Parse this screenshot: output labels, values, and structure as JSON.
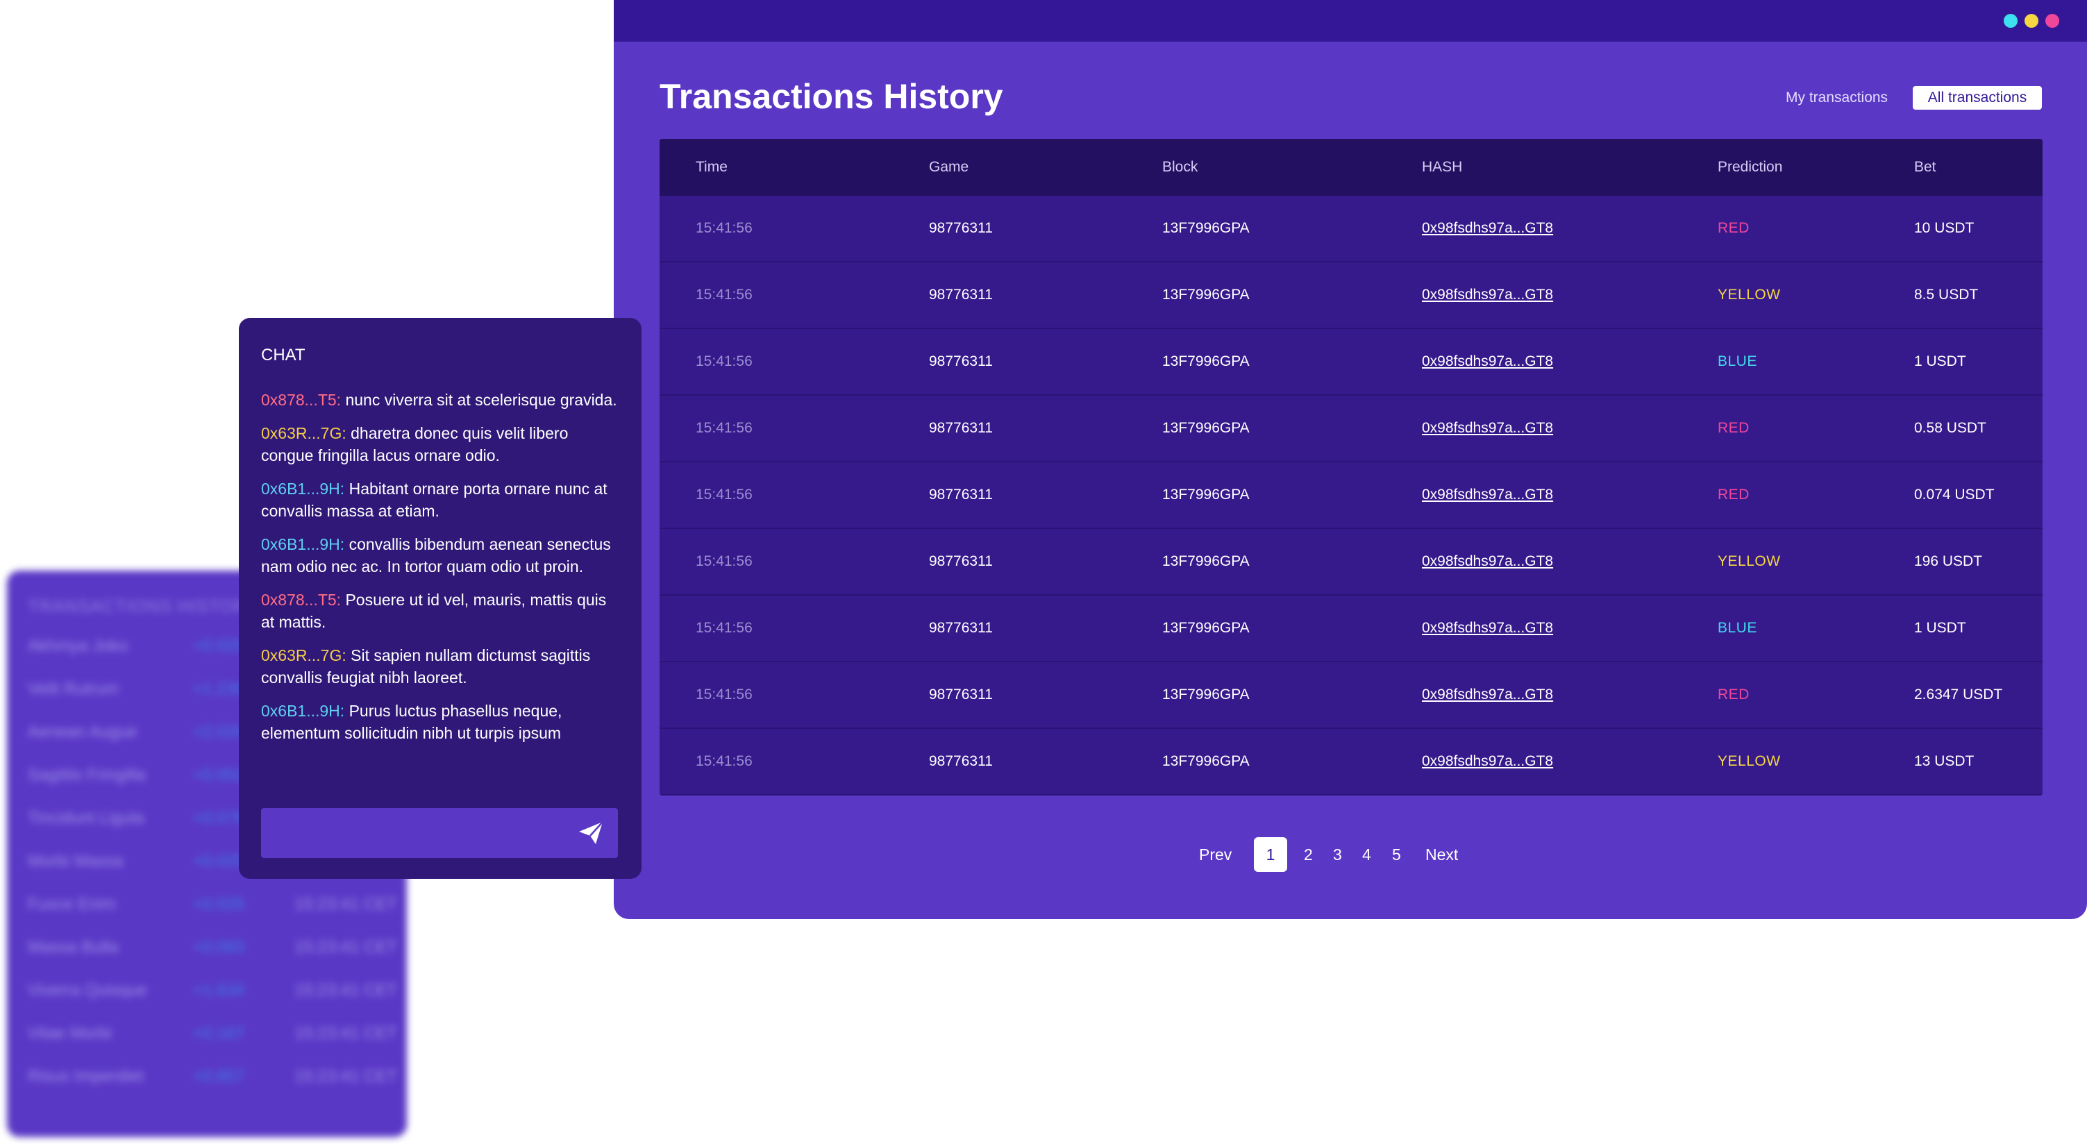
{
  "colors": {
    "window_bg": "#5b37c5",
    "window_bar": "#341796",
    "table_bg": "#361a8c",
    "table_head": "#241060",
    "chat_bg": "#2f1878",
    "red": "#f0479a",
    "yellow": "#f5d742",
    "blue": "#41d8ea",
    "user_red": "#ff6c86",
    "user_yellow": "#f5cc4a",
    "user_cyan": "#5fcdef"
  },
  "window": {
    "dots": [
      {
        "color": "#3ee0ef",
        "name": "cyan-window-dot"
      },
      {
        "color": "#f5d742",
        "name": "yellow-window-dot"
      },
      {
        "color": "#f0479a",
        "name": "pink-window-dot"
      }
    ]
  },
  "main": {
    "title": "Transactions History",
    "tabs": {
      "my": "My transactions",
      "all": "All transactions"
    }
  },
  "table": {
    "headers": {
      "time": "Time",
      "game": "Game",
      "block": "Block",
      "hash": "HASH",
      "prediction": "Prediction",
      "bet": "Bet"
    },
    "rows": [
      {
        "time": "15:41:56",
        "game": "98776311",
        "block": "13F7996GPA",
        "hash": "0x98fsdhs97a...GT8",
        "prediction": "RED",
        "bet": "10 USDT"
      },
      {
        "time": "15:41:56",
        "game": "98776311",
        "block": "13F7996GPA",
        "hash": "0x98fsdhs97a...GT8",
        "prediction": "YELLOW",
        "bet": "8.5 USDT"
      },
      {
        "time": "15:41:56",
        "game": "98776311",
        "block": "13F7996GPA",
        "hash": "0x98fsdhs97a...GT8",
        "prediction": "BLUE",
        "bet": "1 USDT"
      },
      {
        "time": "15:41:56",
        "game": "98776311",
        "block": "13F7996GPA",
        "hash": "0x98fsdhs97a...GT8",
        "prediction": "RED",
        "bet": "0.58 USDT"
      },
      {
        "time": "15:41:56",
        "game": "98776311",
        "block": "13F7996GPA",
        "hash": "0x98fsdhs97a...GT8",
        "prediction": "RED",
        "bet": "0.074 USDT"
      },
      {
        "time": "15:41:56",
        "game": "98776311",
        "block": "13F7996GPA",
        "hash": "0x98fsdhs97a...GT8",
        "prediction": "YELLOW",
        "bet": "196 USDT"
      },
      {
        "time": "15:41:56",
        "game": "98776311",
        "block": "13F7996GPA",
        "hash": "0x98fsdhs97a...GT8",
        "prediction": "BLUE",
        "bet": "1 USDT"
      },
      {
        "time": "15:41:56",
        "game": "98776311",
        "block": "13F7996GPA",
        "hash": "0x98fsdhs97a...GT8",
        "prediction": "RED",
        "bet": "2.6347 USDT"
      },
      {
        "time": "15:41:56",
        "game": "98776311",
        "block": "13F7996GPA",
        "hash": "0x98fsdhs97a...GT8",
        "prediction": "YELLOW",
        "bet": "13 USDT"
      }
    ]
  },
  "pagination": {
    "prev": "Prev",
    "pages": [
      "1",
      "2",
      "3",
      "4",
      "5"
    ],
    "current": "1",
    "next": "Next"
  },
  "chat": {
    "title": "CHAT",
    "input_placeholder": "",
    "send_icon": "send-icon",
    "messages": [
      {
        "user": "0x878...T5:",
        "user_color": "#ff6c86",
        "text": " nunc viverra sit at scelerisque gravida."
      },
      {
        "user": "0x63R...7G:",
        "user_color": "#f5cc4a",
        "text": " dharetra donec quis velit libero congue fringilla lacus ornare odio."
      },
      {
        "user": "0x6B1...9H:",
        "user_color": "#5fcdef",
        "text": " Habitant ornare porta ornare nunc at convallis massa at etiam."
      },
      {
        "user": "0x6B1...9H:",
        "user_color": "#5fcdef",
        "text": " convallis bibendum aenean senectus nam odio nec ac. In tortor quam odio ut proin."
      },
      {
        "user": "0x878...T5:",
        "user_color": "#ff6c86",
        "text": " Posuere ut id vel, mauris, mattis quis at mattis."
      },
      {
        "user": "0x63R...7G:",
        "user_color": "#f5cc4a",
        "text": " Sit sapien nullam dictumst sagittis convallis feugiat nibh laoreet."
      },
      {
        "user": "0x6B1...9H:",
        "user_color": "#5fcdef",
        "text": " Purus luctus phasellus neque, elementum sollicitudin nibh ut turpis ipsum"
      }
    ]
  },
  "background_panel": {
    "title": "TRANSACTIONS HISTORY",
    "rows": [
      {
        "name": "Akhmya Joko",
        "value": "+0.025",
        "time": ""
      },
      {
        "name": "Velit Rutrum",
        "value": "+1.230",
        "time": ""
      },
      {
        "name": "Aenean Augue",
        "value": "+2.028",
        "time": ""
      },
      {
        "name": "Sagittis Fringilla",
        "value": "+0.002",
        "time": ""
      },
      {
        "name": "Tincidunt Ligula",
        "value": "+0.078",
        "time": ""
      },
      {
        "name": "Morbi Massa",
        "value": "+0.025",
        "time": "15:23:41 CET"
      },
      {
        "name": "Fusce Enim",
        "value": "+0.025",
        "time": "15:23:41 CET"
      },
      {
        "name": "Massa Bulla",
        "value": "+0.093",
        "time": "15:23:41 CET"
      },
      {
        "name": "Viverra Quisque",
        "value": "+1.634",
        "time": "15:23:41 CET"
      },
      {
        "name": "Vitae Morbi",
        "value": "+0.167",
        "time": "15:23:41 CET"
      },
      {
        "name": "Risus Imperdiet",
        "value": "+0.857",
        "time": "15:23:41 CET"
      }
    ]
  }
}
